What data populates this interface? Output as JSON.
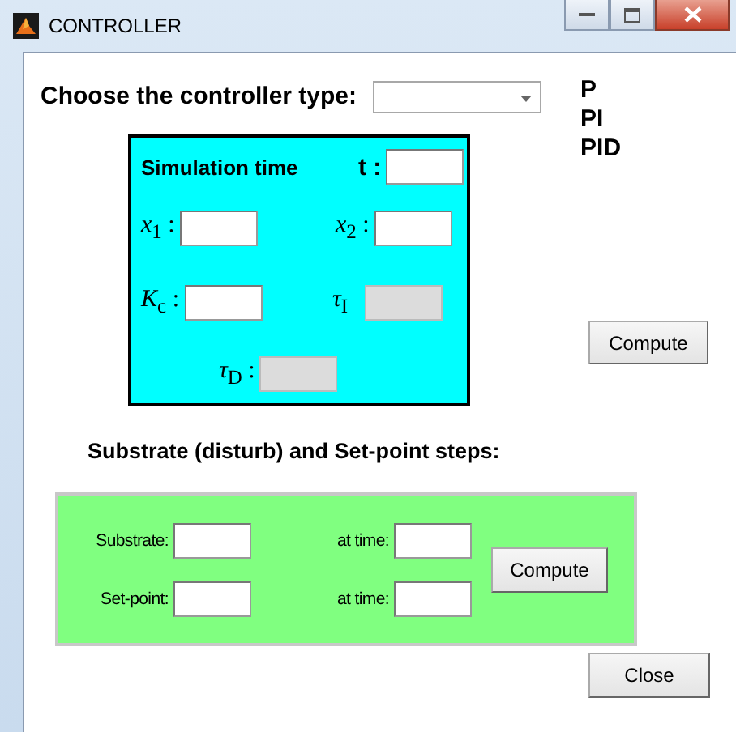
{
  "window": {
    "title": "CONTROLLER"
  },
  "controller_type": {
    "label": "Choose the controller type:",
    "options_text": [
      "P",
      "PI",
      "PID"
    ]
  },
  "simulation_panel": {
    "title": "Simulation time",
    "fields": [
      {
        "label": "t :",
        "disabled": false
      },
      {
        "label": "*x*$_{1}$ :",
        "disabled": false
      },
      {
        "label": "*x*$_{2}$ :",
        "disabled": false
      },
      {
        "label": "*K*$_{c}$ :",
        "disabled": false
      },
      {
        "label": "*τ*$_{I}$",
        "disabled": true
      },
      {
        "label": "*τ*$_{D}$ :",
        "disabled": true
      }
    ]
  },
  "compute_button": "Compute",
  "steps_heading": "Substrate (disturb)  and Set-point steps:",
  "steps_panel": {
    "rows": [
      {
        "label": "Substrate:",
        "time_label": "at time:"
      },
      {
        "label": "Set-point:",
        "time_label": "at time:"
      }
    ],
    "compute_button": "Compute"
  },
  "close_button": "Close"
}
